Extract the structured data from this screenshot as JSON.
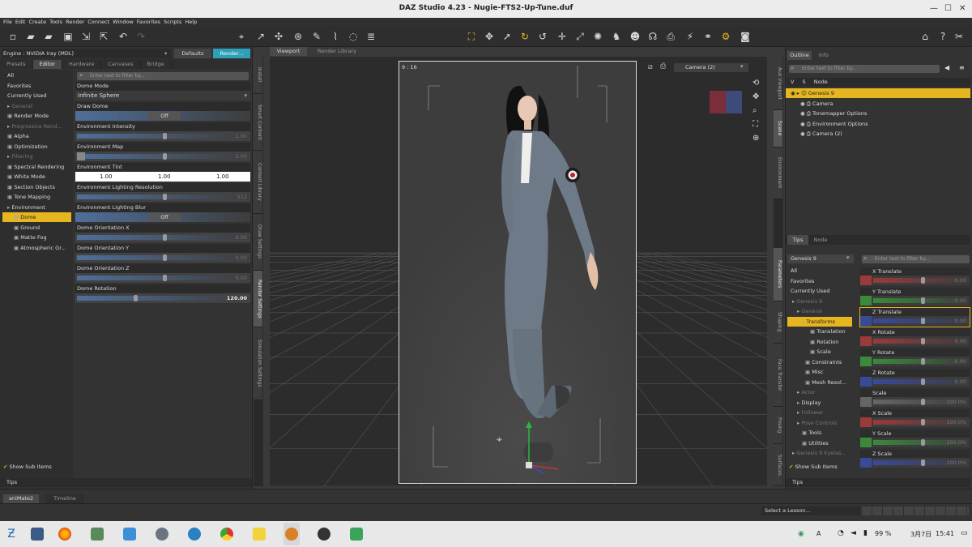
{
  "window": {
    "title": "DAZ Studio 4.23 - Nugie-FTS2-Up-Tune.duf"
  },
  "menu": [
    "File",
    "Edit",
    "Create",
    "Tools",
    "Render",
    "Connect",
    "Window",
    "Favorites",
    "Scripts",
    "Help"
  ],
  "render_pane": {
    "engine_label": "Engine : NVIDIA Iray (MDL)",
    "defaults_button": "Defaults",
    "render_button": "Render...",
    "tabs": [
      "Presets",
      "Editor",
      "Hardware",
      "Canvases",
      "Bridge"
    ],
    "active_tab": "Editor",
    "filter_placeholder": "Enter text to filter by...",
    "categories": [
      {
        "label": "All",
        "state": "normal"
      },
      {
        "label": "Favorites",
        "state": "normal"
      },
      {
        "label": "Currently Used",
        "state": "normal"
      },
      {
        "label": "General",
        "state": "dim"
      },
      {
        "label": "Render Mode",
        "state": "normal"
      },
      {
        "label": "Progressive Rend...",
        "state": "dim"
      },
      {
        "label": "Alpha",
        "state": "normal"
      },
      {
        "label": "Optimization",
        "state": "normal"
      },
      {
        "label": "Filtering",
        "state": "dim"
      },
      {
        "label": "Spectral Rendering",
        "state": "normal"
      },
      {
        "label": "White Mode",
        "state": "normal"
      },
      {
        "label": "Section Objects",
        "state": "normal"
      },
      {
        "label": "Tone Mapping",
        "state": "normal"
      },
      {
        "label": "Environment",
        "state": "normal"
      },
      {
        "label": "Dome",
        "state": "selected"
      },
      {
        "label": "Ground",
        "state": "normal"
      },
      {
        "label": "Matte Fog",
        "state": "normal"
      },
      {
        "label": "Atmospheric Gr...",
        "state": "normal"
      }
    ],
    "properties": [
      {
        "label": "Dome Mode",
        "type": "dropdown",
        "value": "Infinite Sphere"
      },
      {
        "label": "Draw Dome",
        "type": "button",
        "value": "Off"
      },
      {
        "label": "Environment Intensity",
        "type": "slider",
        "value": "1.00",
        "fraction": 0.5
      },
      {
        "label": "Environment Map",
        "type": "slider",
        "value": "2.00",
        "fraction": 0.5
      },
      {
        "label": "Environment Tint",
        "type": "tint",
        "values": [
          "1.00",
          "1.00",
          "1.00"
        ]
      },
      {
        "label": "Environment Lighting Resolution",
        "type": "slider",
        "value": "512",
        "fraction": 0.5
      },
      {
        "label": "Environment Lighting Blur",
        "type": "button",
        "value": "Off"
      },
      {
        "label": "Dome Orientation X",
        "type": "slider",
        "value": "0.00",
        "fraction": 0.5
      },
      {
        "label": "Dome Orientation Y",
        "type": "slider",
        "value": "0.00",
        "fraction": 0.5
      },
      {
        "label": "Dome Orientation Z",
        "type": "slider",
        "value": "0.00",
        "fraction": 0.5
      },
      {
        "label": "Dome Rotation",
        "type": "slider",
        "value": "120.00",
        "fraction": 0.33
      }
    ],
    "show_sub_items": "Show Sub Items",
    "tips": "Tips"
  },
  "side_tabs_left": [
    "Install",
    "Smart Content",
    "Content Library",
    "Draw Settings",
    "Render Settings",
    "Simulation Settings"
  ],
  "viewport": {
    "tabs": [
      "Viewport",
      "Render Library"
    ],
    "camera": "Camera (2)",
    "aspect": "9 : 16"
  },
  "scene_pane": {
    "tabs": [
      "Outline",
      "Info"
    ],
    "filter_placeholder": "Enter text to filter by...",
    "columns": [
      "V",
      "S",
      "Node"
    ],
    "nodes": [
      {
        "label": "Genesis 9",
        "selected": true
      },
      {
        "label": "Camera",
        "selected": false
      },
      {
        "label": "Tonemapper Options",
        "selected": false
      },
      {
        "label": "Environment Options",
        "selected": false
      },
      {
        "label": "Camera (2)",
        "selected": false
      }
    ],
    "side_tabs": [
      "Aux Viewport",
      "Scene",
      "Environment"
    ]
  },
  "params_pane": {
    "tabs": [
      "Tips",
      "Node"
    ],
    "node_select": "Genesis 9",
    "filter_placeholder": "Enter text to filter by...",
    "categories": [
      {
        "label": "All",
        "state": "normal"
      },
      {
        "label": "Favorites",
        "state": "normal"
      },
      {
        "label": "Currently Used",
        "state": "normal"
      },
      {
        "label": "Genesis 9",
        "state": "dim"
      },
      {
        "label": "General",
        "state": "dim"
      },
      {
        "label": "Transforms",
        "state": "selected"
      },
      {
        "label": "Translation",
        "state": "normal"
      },
      {
        "label": "Rotation",
        "state": "normal"
      },
      {
        "label": "Scale",
        "state": "normal"
      },
      {
        "label": "Constraints",
        "state": "normal"
      },
      {
        "label": "Misc",
        "state": "normal"
      },
      {
        "label": "Mesh Resol...",
        "state": "normal"
      },
      {
        "label": "Actor",
        "state": "dim"
      },
      {
        "label": "Display",
        "state": "normal"
      },
      {
        "label": "Follower",
        "state": "dim"
      },
      {
        "label": "Pose Controls",
        "state": "dim"
      },
      {
        "label": "Tools",
        "state": "normal"
      },
      {
        "label": "Utilities",
        "state": "normal"
      },
      {
        "label": "Genesis 9 Eyelas...",
        "state": "dim"
      }
    ],
    "properties": [
      {
        "label": "X Translate",
        "value": "0.00",
        "color": "#9a3a3a"
      },
      {
        "label": "Y Translate",
        "value": "0.00",
        "color": "#3a8a3a"
      },
      {
        "label": "Z Translate",
        "value": "0.00",
        "color": "#3a4a9a"
      },
      {
        "label": "X Rotate",
        "value": "0.00",
        "color": "#9a3a3a"
      },
      {
        "label": "Y Rotate",
        "value": "0.00",
        "color": "#3a8a3a"
      },
      {
        "label": "Z Rotate",
        "value": "0.00",
        "color": "#3a4a9a"
      },
      {
        "label": "Scale",
        "value": "100.0%",
        "color": "#666666"
      },
      {
        "label": "X Scale",
        "value": "100.0%",
        "color": "#9a3a3a"
      },
      {
        "label": "Y Scale",
        "value": "100.0%",
        "color": "#3a8a3a"
      },
      {
        "label": "Z Scale",
        "value": "100.0%",
        "color": "#3a4a9a"
      }
    ],
    "side_tabs": [
      "Parameters",
      "Shaping",
      "Face Transfer",
      "Posing",
      "Surfaces"
    ],
    "show_sub_items": "Show Sub Items",
    "tips": "Tips"
  },
  "bottom": {
    "tabs": [
      "aniMate2",
      "Timeline"
    ],
    "lesson": "Select a Lesson..."
  },
  "taskbar": {
    "battery": "99 %",
    "date": "3月7日",
    "time": "15:41",
    "ime": "A"
  }
}
